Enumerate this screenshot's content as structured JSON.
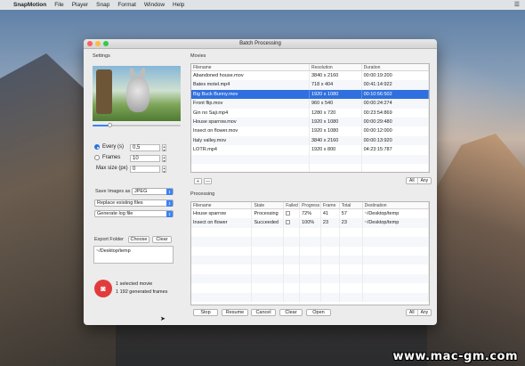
{
  "menubar": {
    "app": "SnapMotion",
    "items": [
      "File",
      "Player",
      "Snap",
      "Format",
      "Window",
      "Help"
    ]
  },
  "window": {
    "title": "Batch Processing"
  },
  "settings": {
    "section_label": "Settings",
    "every_label": "Every (s)",
    "every_value": "0,5",
    "frames_label": "Frames",
    "frames_value": "10",
    "maxsize_label": "Max size (px)",
    "maxsize_value": "0",
    "mode_selected": "every",
    "preview_progress": 0.2,
    "save_images_label": "Save Images as",
    "format_value": "JPEG",
    "replace_value": "Replace existing files",
    "log_value": "Generate log file",
    "export_folder_label": "Export Folder",
    "choose_label": "Choose",
    "clear_label": "Clear",
    "export_path": "~/Desktop/temp",
    "summary_movies": "1 selected movie",
    "summary_frames": "1 192 generated frames"
  },
  "movies": {
    "section_label": "Movies",
    "columns": [
      "Filename",
      "Resolution",
      "Duration"
    ],
    "rows": [
      [
        "Abandoned house.mov",
        "3840 x 2160",
        "00:00:19:200"
      ],
      [
        "Bates motel.mp4",
        "718 x 404",
        "00:41:14:922"
      ],
      [
        "Big Buck Bunny.mov",
        "1920 x 1080",
        "00:10:56:502"
      ],
      [
        "Front flip.mov",
        "960 x 540",
        "00:00:24:274"
      ],
      [
        "Gin no Saji.mp4",
        "1280 x 720",
        "00:23:54:869"
      ],
      [
        "House sparrow.mov",
        "1920 x 1080",
        "00:00:29:480"
      ],
      [
        "Insect on flower.mov",
        "1920 x 1080",
        "00:00:12:000"
      ],
      [
        "Italy valley.mov",
        "3840 x 2160",
        "00:00:13:920"
      ],
      [
        "LOTR.mp4",
        "1920 x 800",
        "04:23:15:787"
      ]
    ],
    "selected_index": 2,
    "add_label": "+",
    "remove_label": "—",
    "all_label": "All",
    "any_label": "Any"
  },
  "processing": {
    "section_label": "Processing",
    "columns": [
      "Filename",
      "State",
      "Failed",
      "Progress",
      "Frame",
      "Total",
      "Destination"
    ],
    "rows": [
      [
        "House sparrow",
        "Processing",
        "",
        "72%",
        "41",
        "57",
        "~/Desktop/temp"
      ],
      [
        "Insect on flower",
        "Succeeded",
        "",
        "100%",
        "23",
        "23",
        "~/Desktop/temp"
      ]
    ],
    "buttons": [
      "Stop",
      "Resume",
      "Cancel",
      "Clear",
      "Open"
    ],
    "all_label": "All",
    "any_label": "Any"
  },
  "watermark": "www.mac-gm.com"
}
